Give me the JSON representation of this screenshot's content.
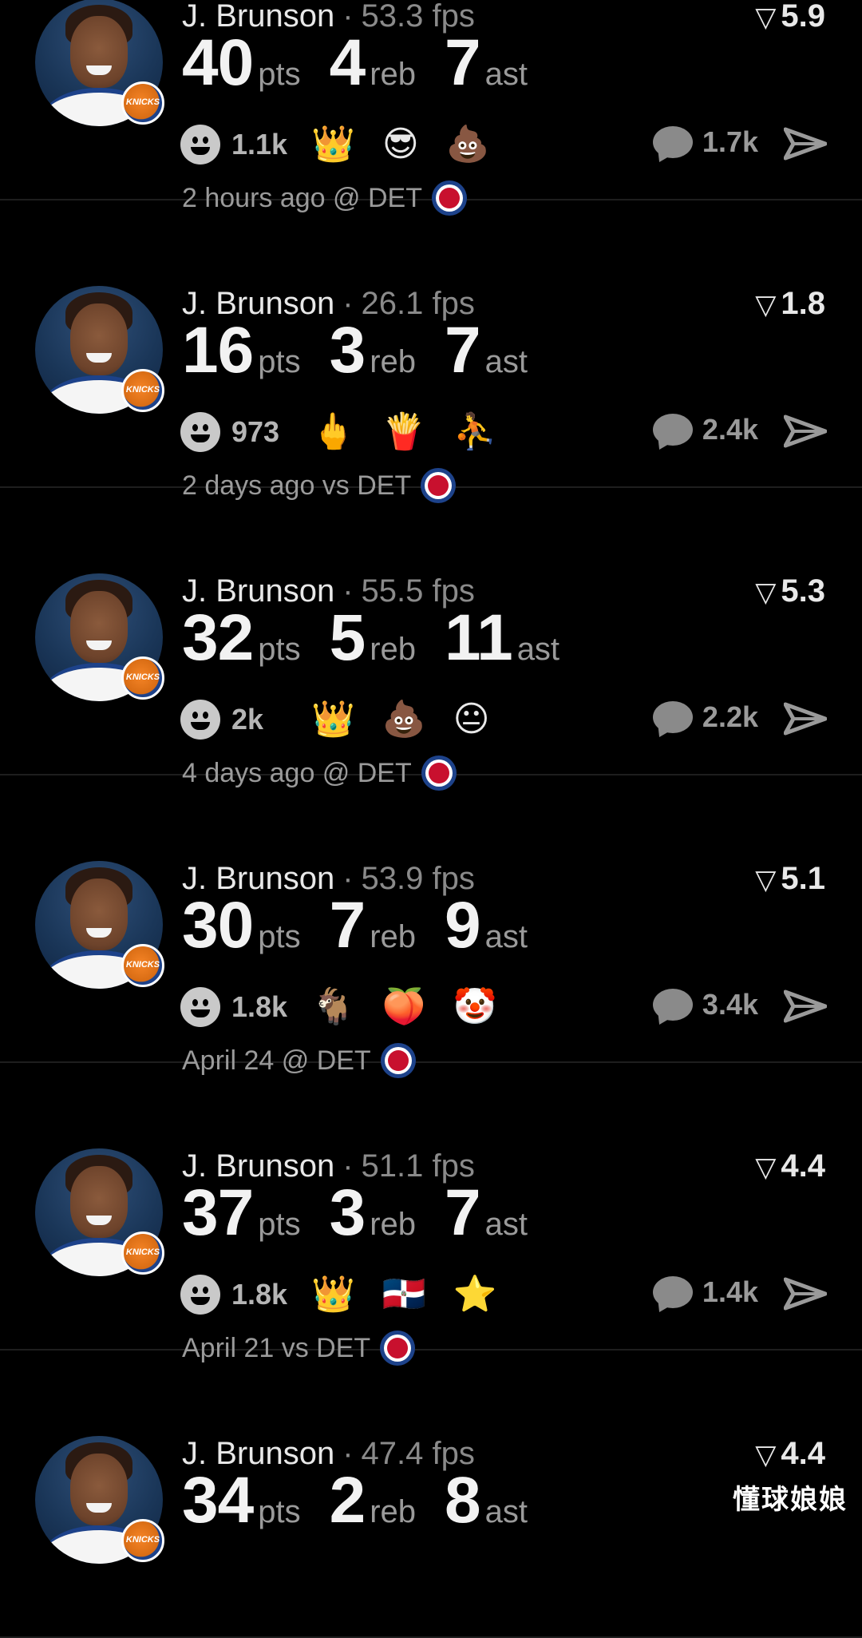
{
  "posts": [
    {
      "player": "J. Brunson",
      "fps": "53.3 fps",
      "rating": "5.9",
      "stats": [
        {
          "num": "40",
          "unit": "pts"
        },
        {
          "num": "4",
          "unit": "reb"
        },
        {
          "num": "7",
          "unit": "ast"
        }
      ],
      "reaction_count": "1.1k",
      "emojis": [
        "👑",
        "😎",
        "💩"
      ],
      "comment_count": "1.7k",
      "time": "2 hours ago @ DET"
    },
    {
      "player": "J. Brunson",
      "fps": "26.1 fps",
      "rating": "1.8",
      "stats": [
        {
          "num": "16",
          "unit": "pts"
        },
        {
          "num": "3",
          "unit": "reb"
        },
        {
          "num": "7",
          "unit": "ast"
        }
      ],
      "reaction_count": "973",
      "emojis": [
        "🖕",
        "🍟",
        "⛹"
      ],
      "comment_count": "2.4k",
      "time": "2 days ago vs DET"
    },
    {
      "player": "J. Brunson",
      "fps": "55.5 fps",
      "rating": "5.3",
      "stats": [
        {
          "num": "32",
          "unit": "pts"
        },
        {
          "num": "5",
          "unit": "reb"
        },
        {
          "num": "11",
          "unit": "ast"
        }
      ],
      "reaction_count": "2k",
      "emojis": [
        "👑",
        "💩",
        "😐"
      ],
      "comment_count": "2.2k",
      "time": "4 days ago @ DET"
    },
    {
      "player": "J. Brunson",
      "fps": "53.9 fps",
      "rating": "5.1",
      "stats": [
        {
          "num": "30",
          "unit": "pts"
        },
        {
          "num": "7",
          "unit": "reb"
        },
        {
          "num": "9",
          "unit": "ast"
        }
      ],
      "reaction_count": "1.8k",
      "emojis": [
        "🐐",
        "🍑",
        "🤡"
      ],
      "comment_count": "3.4k",
      "time": "April 24 @ DET"
    },
    {
      "player": "J. Brunson",
      "fps": "51.1 fps",
      "rating": "4.4",
      "stats": [
        {
          "num": "37",
          "unit": "pts"
        },
        {
          "num": "3",
          "unit": "reb"
        },
        {
          "num": "7",
          "unit": "ast"
        }
      ],
      "reaction_count": "1.8k",
      "emojis": [
        "👑",
        "🇩🇴",
        "⭐"
      ],
      "comment_count": "1.4k",
      "time": "April 21 vs DET"
    },
    {
      "player": "J. Brunson",
      "fps": "47.4 fps",
      "rating": "4.4",
      "stats": [
        {
          "num": "34",
          "unit": "pts"
        },
        {
          "num": "2",
          "unit": "reb"
        },
        {
          "num": "8",
          "unit": "ast"
        }
      ],
      "reaction_count": "",
      "emojis": [],
      "comment_count": "",
      "time": ""
    }
  ],
  "icons": {
    "rating": "rating-triangle-icon",
    "reaction": "smiley-icon",
    "comment": "comment-bubble-icon",
    "share": "share-arrow-icon",
    "team_logo": "pistons-logo-icon",
    "player_badge": "knicks-badge-icon"
  },
  "knicks_badge_text": "KNICKS",
  "colors": {
    "background": "#000000",
    "text_primary": "#f2f2f2",
    "text_secondary": "#9a9a9a",
    "knicks_blue": "#1d428a",
    "knicks_orange": "#f58426",
    "pistons_red": "#c8102e"
  },
  "watermark": "懂球娘娘"
}
